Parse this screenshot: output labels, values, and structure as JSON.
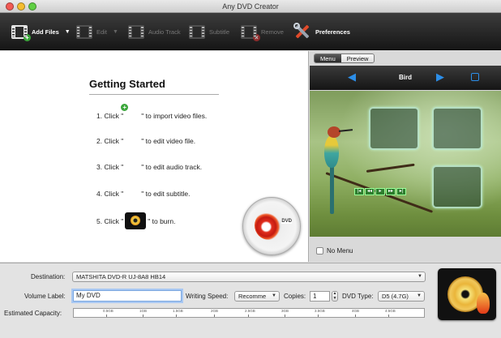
{
  "window": {
    "title": "Any DVD Creator"
  },
  "toolbar": {
    "add_files": "Add Files",
    "edit": "Edit",
    "audio_track": "Audio Track",
    "subtitle": "Subtitle",
    "remove": "Remove",
    "preferences": "Preferences"
  },
  "getting_started": {
    "title": "Getting Started",
    "steps": [
      {
        "prefix": "1. Click \"",
        "suffix": "\" to import video files."
      },
      {
        "prefix": "2. Click \"",
        "suffix": "\" to edit video file."
      },
      {
        "prefix": "3. Click \"",
        "suffix": "\" to edit audio track."
      },
      {
        "prefix": "4. Click \"",
        "suffix": "\" to edit subtitle."
      },
      {
        "prefix": "5. Click \"",
        "suffix": "\" to burn."
      }
    ]
  },
  "menu_panel": {
    "tabs": [
      "Menu",
      "Preview"
    ],
    "active_tab": "Menu",
    "template_name": "Bird",
    "no_menu_label": "No Menu",
    "no_menu_checked": false
  },
  "form": {
    "destination_label": "Destination:",
    "destination_value": "MATSHITA DVD-R   UJ-8A8 HB14",
    "volume_label_label": "Volume Label:",
    "volume_label_value": "My DVD",
    "writing_speed_label": "Writing Speed:",
    "writing_speed_value": "Recomme",
    "copies_label": "Copies:",
    "copies_value": "1",
    "dvd_type_label": "DVD Type:",
    "dvd_type_value": "D5 (4.7G)",
    "capacity_label": "Estimated Capacity:",
    "capacity_ticks": [
      "0.5GB",
      "1GB",
      "1.5GB",
      "2GB",
      "2.5GB",
      "3GB",
      "3.5GB",
      "4GB",
      "4.5GB"
    ]
  },
  "colors": {
    "accent_blue": "#2c8ee8",
    "toolbar_bg": "#1e1e1e"
  },
  "icons": {
    "add_files": "film-add-icon",
    "edit": "film-edit-icon",
    "audio_track": "film-audio-icon",
    "subtitle": "film-subtitle-icon",
    "remove": "film-remove-icon",
    "preferences": "tools-icon",
    "burn": "burn-disc-icon"
  }
}
